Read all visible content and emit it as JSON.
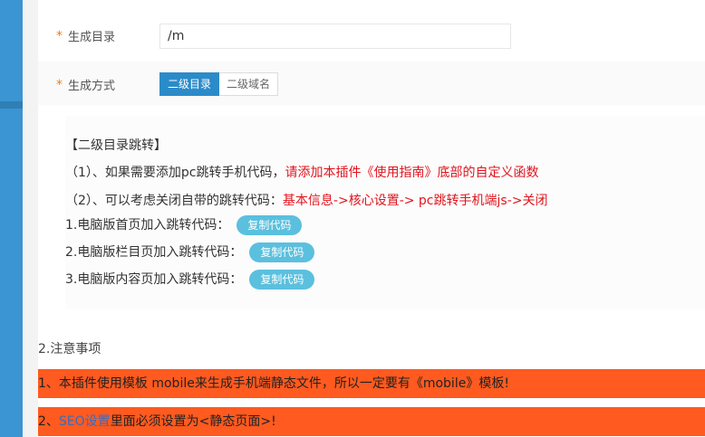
{
  "form": {
    "dir_label": "生成目录",
    "dir_value": "/m",
    "mode_label": "生成方式",
    "mode_options": [
      "二级目录",
      "二级域名"
    ],
    "mode_selected": "二级目录",
    "required_mark": "*"
  },
  "info": {
    "title": "【二级目录跳转】",
    "tip1_prefix": "（1）、如果需要添加pc跳转手机代码，",
    "tip1_red": "请添加本插件《使用指南》底部的自定义函数",
    "tip2_prefix": "（2）、可以考虑关闭自带的跳转代码：",
    "tip2_red": "基本信息->核心设置-> pc跳转手机端js->关闭",
    "items": [
      {
        "label": "1.电脑版首页加入跳转代码：",
        "button": "复制代码"
      },
      {
        "label": "2.电脑版栏目页加入跳转代码：",
        "button": "复制代码"
      },
      {
        "label": "3.电脑版内容页加入跳转代码：",
        "button": "复制代码"
      }
    ]
  },
  "notes": {
    "title": "2.注意事项",
    "banner1": "1、本插件使用模板 mobile来生成手机端静态文件，所以一定要有《mobile》模板!",
    "banner2_prefix": "2、",
    "banner2_link": "SEO设置",
    "banner2_suffix": "里面必须设置为<静态页面>!"
  },
  "colors": {
    "accent": "#2b8bc9",
    "copy_button": "#5bc0de",
    "banner": "#ff5a1f",
    "warning_text": "#e0141e",
    "required": "#f07b1c"
  }
}
